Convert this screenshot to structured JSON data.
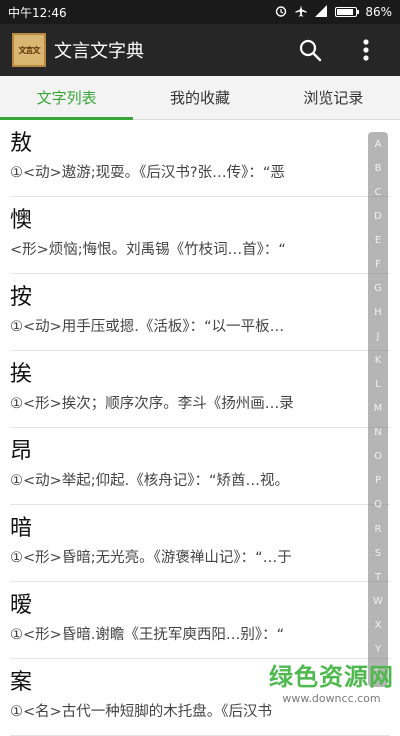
{
  "status_bar": {
    "time": "中午12:46",
    "battery": "86%",
    "battery_level": 0.86
  },
  "app_bar": {
    "logo_text": "文言文",
    "title": "文言文字典",
    "search_icon": "search-icon",
    "more_icon": "more-vert-icon"
  },
  "tabs": [
    {
      "label": "文字列表",
      "active": true
    },
    {
      "label": "我的收藏",
      "active": false
    },
    {
      "label": "浏览记录",
      "active": false
    }
  ],
  "entries": [
    {
      "char": "敖",
      "def": "①<动>遨游;现耍。《后汉书?张…传》：“恶"
    },
    {
      "char": "懊",
      "def": "<形>烦恼;悔恨。刘禹锡《竹枝词…首》：“"
    },
    {
      "char": "按",
      "def": "①<动>用手压或摁.《活板》：“以一平板…"
    },
    {
      "char": "挨",
      "def": "①<形>挨次；顺序次序。李斗《扬州画…录"
    },
    {
      "char": "昂",
      "def": "①<动>举起;仰起.《核舟记》：“矫酋…视。"
    },
    {
      "char": "暗",
      "def": "①<形>昏暗;无光亮。《游褒禅山记》：“…于"
    },
    {
      "char": "暧",
      "def": "①<形>昏暗.谢瞻《王抚军庾西阳…别》：“"
    },
    {
      "char": "案",
      "def": "①<名>古代一种短脚的木托盘。《后汉书"
    }
  ],
  "alphabet": [
    "A",
    "B",
    "C",
    "D",
    "E",
    "F",
    "G",
    "H",
    "J",
    "K",
    "L",
    "M",
    "N",
    "O",
    "P",
    "Q",
    "R",
    "S",
    "T",
    "W",
    "X",
    "Y",
    "Z"
  ],
  "watermark": {
    "title": "绿色资源网",
    "url": "www.downcc.com"
  },
  "colors": {
    "accent": "#3aa53a",
    "app_bar": "#262626",
    "status_bar": "#1a1a1a"
  }
}
